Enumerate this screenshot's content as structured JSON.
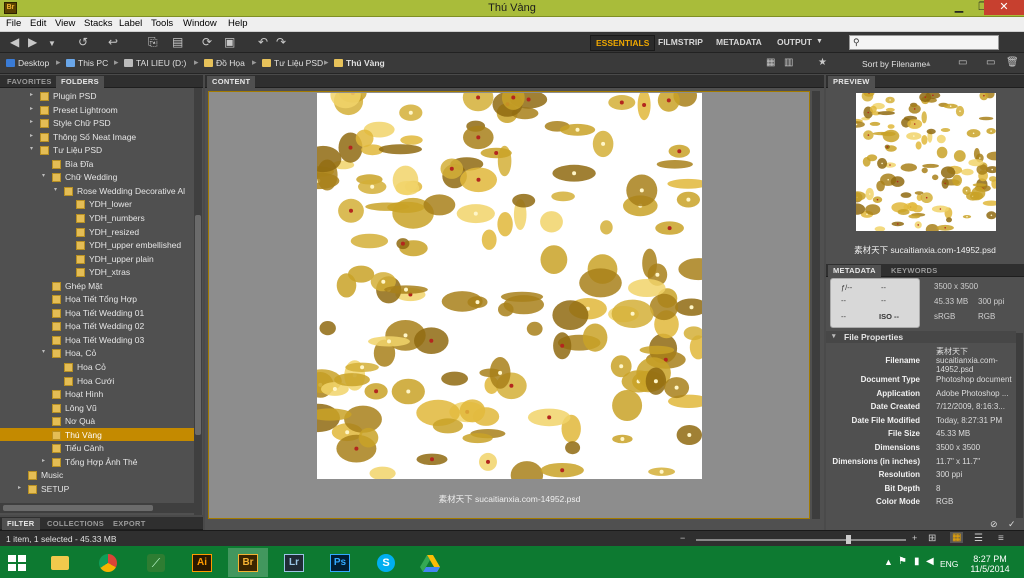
{
  "window": {
    "title": "Thú Vàng",
    "app_icon_label": "Br"
  },
  "menu": [
    "File",
    "Edit",
    "View",
    "Stacks",
    "Label",
    "Tools",
    "Window",
    "Help"
  ],
  "workspaces": [
    "ESSENTIALS",
    "FILMSTRIP",
    "METADATA",
    "OUTPUT"
  ],
  "breadcrumbs": [
    "Desktop",
    "This PC",
    "TAI LIEU (D:)",
    "Đồ Họa",
    "Tư Liệu PSD",
    "Thú Vàng"
  ],
  "sort_label": "Sort by Filename",
  "left_tabs": [
    "FAVORITES",
    "FOLDERS"
  ],
  "tree": [
    {
      "label": "Plugin PSD",
      "indent": 3,
      "twisty": "▸"
    },
    {
      "label": "Preset Lightroom",
      "indent": 3,
      "twisty": "▸"
    },
    {
      "label": "Style Chữ PSD",
      "indent": 3,
      "twisty": "▸"
    },
    {
      "label": "Thông Số Neat Image",
      "indent": 3,
      "twisty": "▸"
    },
    {
      "label": "Tư Liệu PSD",
      "indent": 3,
      "twisty": "▾"
    },
    {
      "label": "Bìa Đĩa",
      "indent": 4,
      "twisty": ""
    },
    {
      "label": "Chữ  Wedding",
      "indent": 4,
      "twisty": "▾"
    },
    {
      "label": "Rose Wedding Decorative Al",
      "indent": 5,
      "twisty": "▾"
    },
    {
      "label": "YDH_lower",
      "indent": 6,
      "twisty": ""
    },
    {
      "label": "YDH_numbers",
      "indent": 6,
      "twisty": ""
    },
    {
      "label": "YDH_resized",
      "indent": 6,
      "twisty": ""
    },
    {
      "label": "YDH_upper embellished",
      "indent": 6,
      "twisty": ""
    },
    {
      "label": "YDH_upper plain",
      "indent": 6,
      "twisty": ""
    },
    {
      "label": "YDH_xtras",
      "indent": 6,
      "twisty": ""
    },
    {
      "label": "Ghép Mặt",
      "indent": 4,
      "twisty": ""
    },
    {
      "label": "Họa Tiết Tổng Hợp",
      "indent": 4,
      "twisty": ""
    },
    {
      "label": "Họa Tiết Wedding 01",
      "indent": 4,
      "twisty": ""
    },
    {
      "label": "Họa Tiết Wedding 02",
      "indent": 4,
      "twisty": ""
    },
    {
      "label": "Họa Tiết Wedding 03",
      "indent": 4,
      "twisty": ""
    },
    {
      "label": "Hoa, Cỏ",
      "indent": 4,
      "twisty": "▾"
    },
    {
      "label": "Hoa Cỏ",
      "indent": 5,
      "twisty": ""
    },
    {
      "label": "Hoa Cưới",
      "indent": 5,
      "twisty": ""
    },
    {
      "label": "Hoạt Hình",
      "indent": 4,
      "twisty": ""
    },
    {
      "label": "Lông Vũ",
      "indent": 4,
      "twisty": ""
    },
    {
      "label": "Nơ Quà",
      "indent": 4,
      "twisty": ""
    },
    {
      "label": "Thú Vàng",
      "indent": 4,
      "twisty": "",
      "selected": true
    },
    {
      "label": "Tiểu Cảnh",
      "indent": 4,
      "twisty": ""
    },
    {
      "label": "Tổng Hợp Ảnh Thẻ",
      "indent": 4,
      "twisty": "▸"
    },
    {
      "label": "Music",
      "indent": 2,
      "twisty": ""
    },
    {
      "label": "SETUP",
      "indent": 2,
      "twisty": "▸"
    }
  ],
  "bottom_tabs": [
    "FILTER",
    "COLLECTIONS",
    "EXPORT"
  ],
  "content_tab": "CONTENT",
  "preview_tab": "PREVIEW",
  "meta_tabs": [
    "METADATA",
    "KEYWORDS"
  ],
  "file_caption": "素材天下 sucaitianxia.com-14952.psd",
  "camera": {
    "aperture": "ƒ/--",
    "shutter": "--",
    "c1": "--",
    "c2": "--",
    "c3": "--",
    "iso": "ISO --"
  },
  "fileinfo": {
    "dims": "3500 x 3500",
    "size": "45.33 MB",
    "ppi": "300 ppi",
    "cs": "sRGB",
    "mode": "RGB"
  },
  "file_properties_title": "File Properties",
  "props": [
    {
      "k": "Filename",
      "v": "素材天下 sucaitianxia.com-14952.psd"
    },
    {
      "k": "Document Type",
      "v": "Photoshop document"
    },
    {
      "k": "Application",
      "v": "Adobe Photoshop ..."
    },
    {
      "k": "Date Created",
      "v": "7/12/2009, 8:16:3..."
    },
    {
      "k": "Date File Modified",
      "v": "Today, 8:27:31 PM"
    },
    {
      "k": "File Size",
      "v": "45.33 MB"
    },
    {
      "k": "Dimensions",
      "v": "3500 x 3500"
    },
    {
      "k": "Dimensions (in inches)",
      "v": "11.7\" x 11.7\""
    },
    {
      "k": "Resolution",
      "v": "300 ppi"
    },
    {
      "k": "Bit Depth",
      "v": "8"
    },
    {
      "k": "Color Mode",
      "v": "RGB"
    }
  ],
  "status": "1 item, 1 selected - 45.33 MB",
  "taskbar": {
    "apps": [
      "file-explorer",
      "chrome",
      "app-green",
      "illustrator",
      "bridge",
      "lightroom",
      "photoshop",
      "skype",
      "drive"
    ],
    "active": "bridge",
    "lang": "ENG",
    "time": "8:27 PM",
    "date": "11/5/2014"
  },
  "app_labels": {
    "illustrator": "Ai",
    "bridge": "Br",
    "lightroom": "Lr",
    "photoshop": "Ps"
  },
  "colors": {
    "accent": "#c48a00",
    "taskbar": "#0d7a31",
    "titlebar": "#a9bc3a"
  }
}
